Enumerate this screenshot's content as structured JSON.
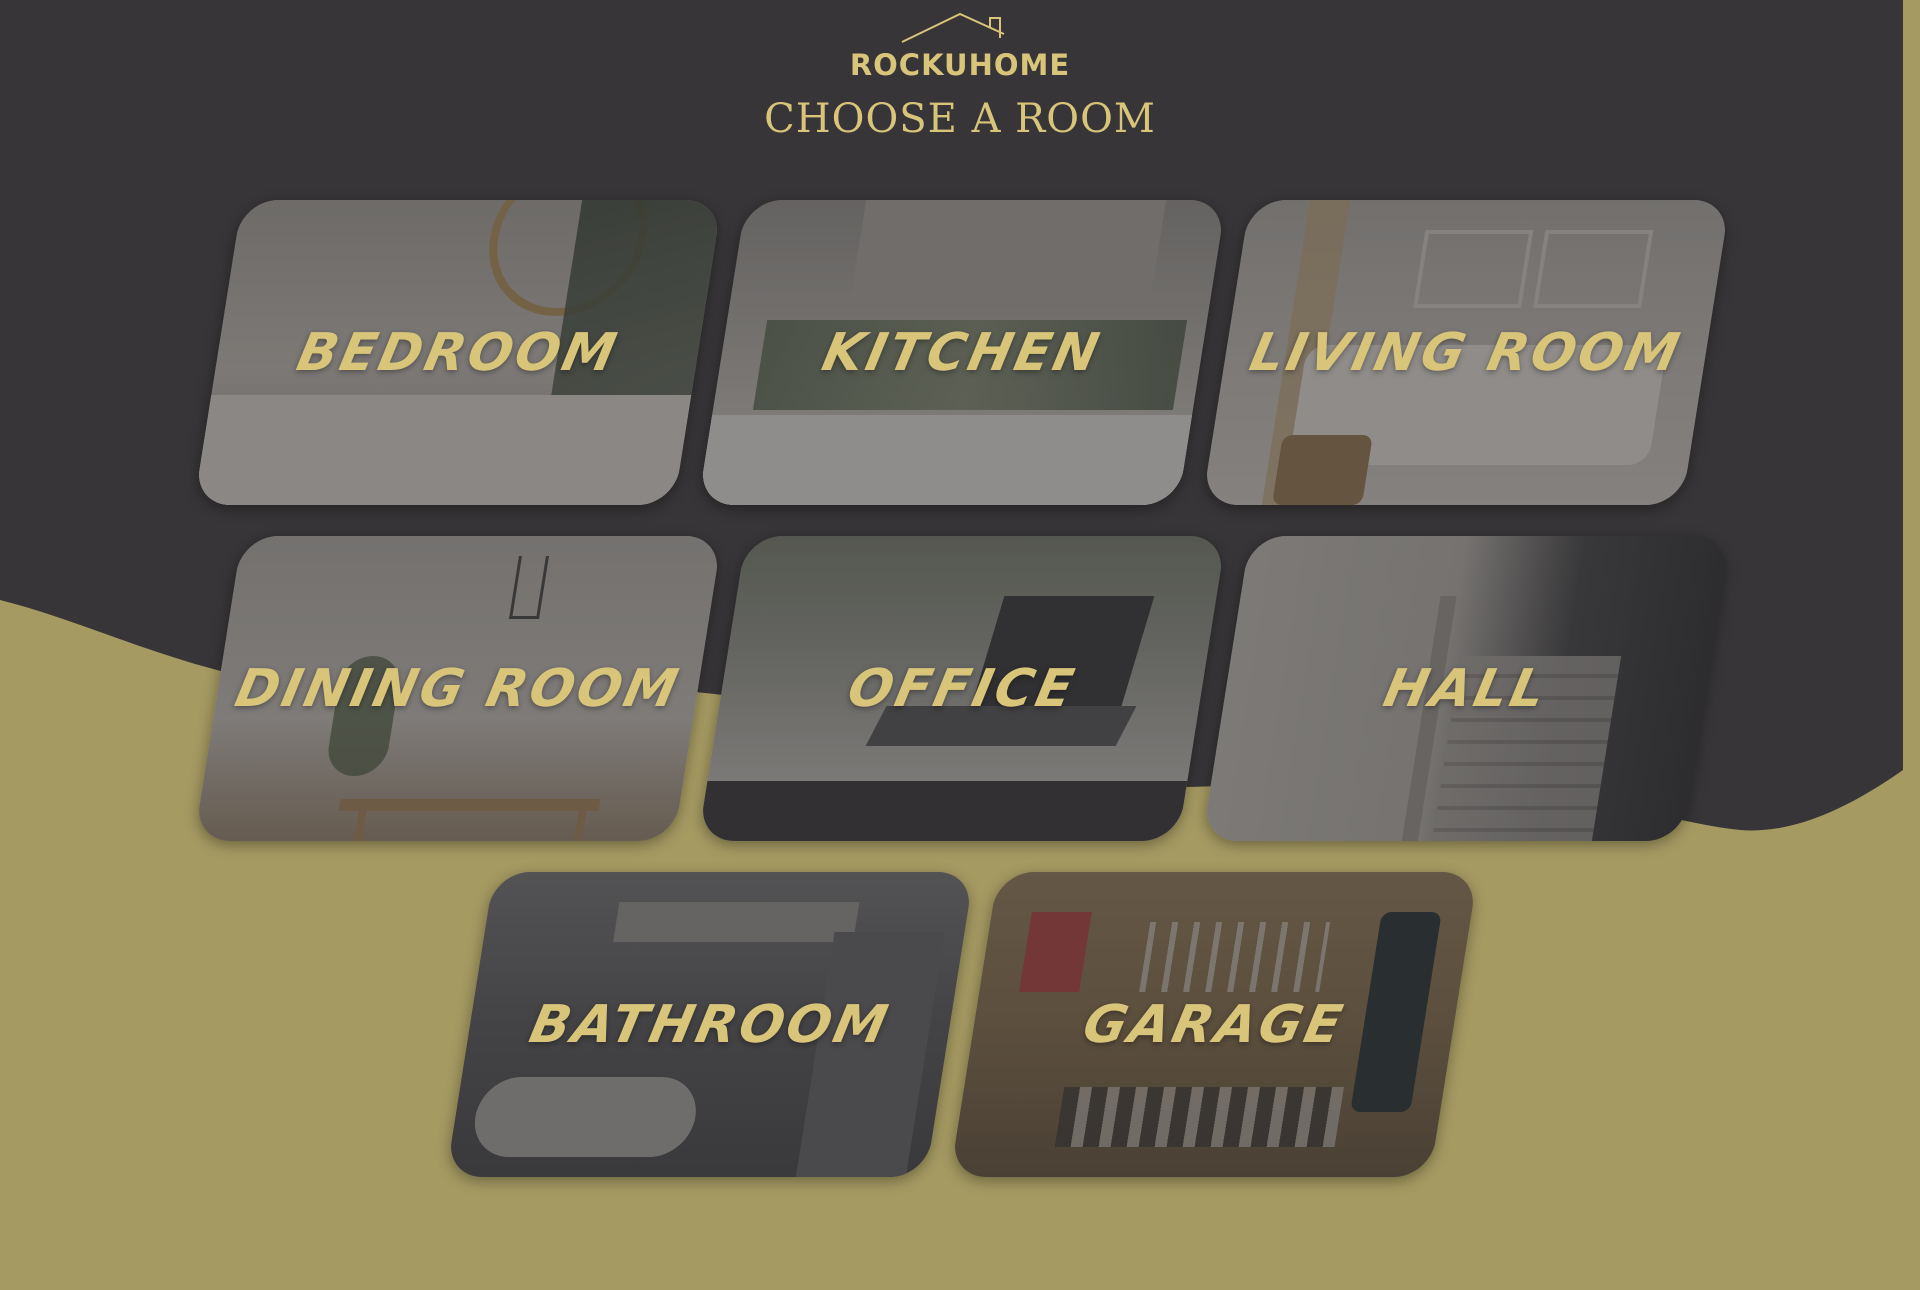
{
  "brand": {
    "name": "ROCKUHOME"
  },
  "page": {
    "title": "CHOOSE A ROOM"
  },
  "colors": {
    "dark_bg": "#373537",
    "gold_bg": "#a59a62",
    "accent": "#d8c57a"
  },
  "rooms": [
    {
      "label": "BEDROOM"
    },
    {
      "label": "KITCHEN"
    },
    {
      "label": "LIVING ROOM"
    },
    {
      "label": "DINING ROOM"
    },
    {
      "label": "OFFICE"
    },
    {
      "label": "HALL"
    },
    {
      "label": "BATHROOM"
    },
    {
      "label": "GARAGE"
    }
  ]
}
